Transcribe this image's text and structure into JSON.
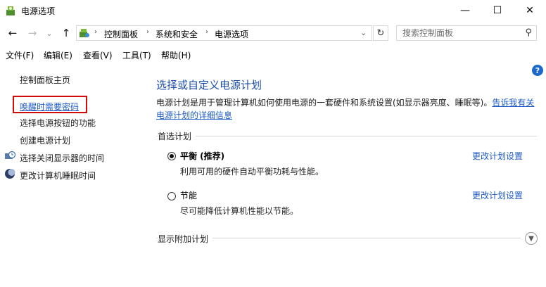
{
  "window": {
    "title": "电源选项",
    "minimize": "—",
    "maximize": "☐",
    "close": "✕"
  },
  "nav": {
    "back": "←",
    "forward": "→",
    "dropdown": "⌄",
    "up": "↑",
    "breadcrumbs": [
      "控制面板",
      "系统和安全",
      "电源选项"
    ],
    "separator": "›",
    "address_dropdown": "⌄",
    "refresh": "↻",
    "search_placeholder": "搜索控制面板",
    "search_glyph": "⚲"
  },
  "menubar": [
    "文件(F)",
    "编辑(E)",
    "查看(V)",
    "工具(T)",
    "帮助(H)"
  ],
  "help_glyph": "?",
  "sidebar": {
    "home": "控制面板主页",
    "items": [
      "唤醒时需要密码",
      "选择电源按钮的功能",
      "创建电源计划",
      "选择关闭显示器的时间",
      "更改计算机睡眠时间"
    ]
  },
  "main": {
    "title": "选择或自定义电源计划",
    "description": "电源计划是用于管理计算机如何使用电源的一套硬件和系统设置(如显示器亮度、睡眠等)。",
    "description_link": "告诉我有关电源计划的详细信息",
    "preferred_label": "首选计划",
    "plans": [
      {
        "name": "平衡 (推荐)",
        "desc": "利用可用的硬件自动平衡功耗与性能。",
        "link": "更改计划设置",
        "selected": true
      },
      {
        "name": "节能",
        "desc": "尽可能降低计算机性能以节能。",
        "link": "更改计划设置",
        "selected": false
      }
    ],
    "additional_label": "显示附加计划"
  },
  "colors": {
    "link": "#1e5bc6",
    "title": "#1b4eab",
    "highlight": "#d10a0a",
    "help": "#1c69c9"
  }
}
